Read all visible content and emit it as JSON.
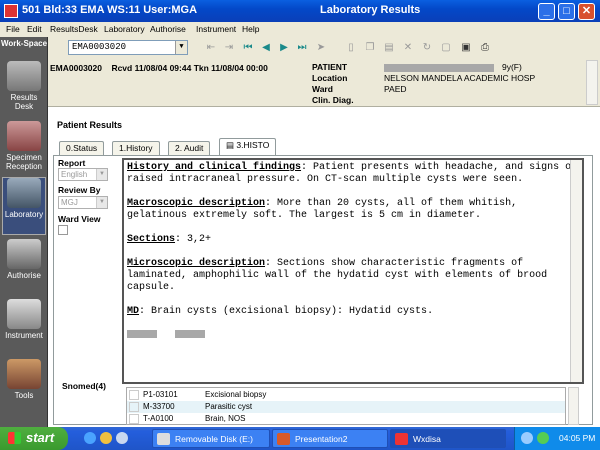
{
  "window": {
    "title_left": "501 Bld:33 EMA WS:11 User:MGA",
    "title_center": "Laboratory Results",
    "btn_min": "_",
    "btn_max": "□",
    "btn_close": "✕"
  },
  "menu": [
    "File",
    "Edit",
    "ResultsDesk",
    "Laboratory",
    "Authorise",
    "Instrument",
    "Help"
  ],
  "toolbar": {
    "workspace_label": "Work-Space",
    "episode_combo": "EMA0003020",
    "icons": [
      "import-icon",
      "export-icon",
      "first-icon",
      "prev-icon",
      "next-icon",
      "last-icon",
      "goto-icon",
      "new-doc-icon",
      "copy-icon",
      "paste-icon",
      "delete-icon",
      "refresh-icon",
      "lock-icon",
      "display-icon",
      "print-icon"
    ]
  },
  "sidebar": [
    {
      "label": "Results Desk",
      "icon": "results-desk-icon"
    },
    {
      "label": "Specimen Reception",
      "icon": "specimen-reception-icon"
    },
    {
      "label": "Laboratory",
      "icon": "laboratory-icon"
    },
    {
      "label": "Authorise",
      "icon": "authorise-icon"
    },
    {
      "label": "Instrument",
      "icon": "instrument-icon"
    },
    {
      "label": "Tools",
      "icon": "tools-icon"
    }
  ],
  "header": {
    "episode": "EMA0003020",
    "received": "Rcvd 11/08/04 09:44",
    "taken": "Tkn 11/08/04 00:00",
    "patient_label": "PATIENT",
    "patient_age": "9y(F)",
    "location_label": "Location",
    "location_value": "NELSON MANDELA ACADEMIC HOSP",
    "ward_label": "Ward",
    "ward_value": "PAED",
    "clin_label": "Clin. Diag."
  },
  "results": {
    "title": "Patient Results",
    "tabs": [
      "0.Status",
      "1.History",
      "2. Audit",
      "3.HISTO"
    ],
    "active_tab": 3,
    "report_label": "Report",
    "report_value": "English",
    "review_label": "Review By",
    "review_value": "MGJ",
    "wardview_label": "Ward View",
    "report_text": {
      "h1": "History and clinical findings",
      "t1": ": Patient presents with headache, and signs of raised intracraneal pressure. On CT-scan multiple cysts were seen.",
      "h2": "Macroscopic description",
      "t2": ": More than 20 cysts, all of them whitish, gelatinous extremely soft. The largest is 5 cm in diameter.",
      "h3": "Sections",
      "t3": ": 3,2+",
      "h4": "Microscopic description",
      "t4": ": Sections show characteristic fragments of laminated, amphophilic wall of the hydatid cyst with elements of brood capsule.",
      "h5": "MD",
      "t5": ": Brain cysts (excisional biopsy): Hydatid cysts."
    },
    "snomed_label": "Snomed(4)",
    "snomed_rows": [
      {
        "code": "P1-03101",
        "desc": "Excisional biopsy"
      },
      {
        "code": "M-33700",
        "desc": "Parasitic cyst"
      },
      {
        "code": "T-A0100",
        "desc": "Brain, NOS"
      }
    ]
  },
  "taskbar": {
    "start": "start",
    "tasks": [
      {
        "label": "Removable Disk (E:)",
        "icon": "drive-icon"
      },
      {
        "label": "Presentation2",
        "icon": "powerpoint-icon"
      },
      {
        "label": "Wxdisa",
        "icon": "app-icon"
      }
    ],
    "clock": "04:05 PM"
  }
}
